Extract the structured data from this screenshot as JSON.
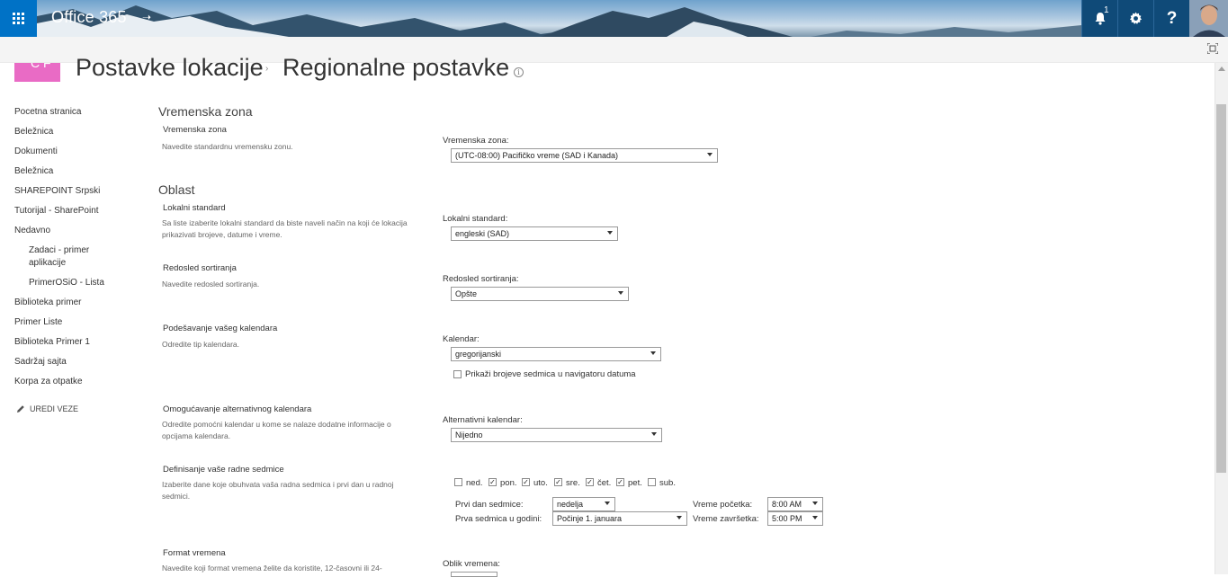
{
  "suite": {
    "brand": "Office 365",
    "notification_count": "1",
    "help_label": "?"
  },
  "page": {
    "breadcrumb_parent": "Postavke lokacije",
    "breadcrumb_separator": "›",
    "title": "Regionalne postavke",
    "logo_text": "C F"
  },
  "nav": {
    "items": [
      "Pocetna stranica",
      "Beležnica",
      "Dokumenti",
      "Beležnica",
      "SHAREPOINT Srpski",
      "Tutorijal - SharePoint",
      "Nedavno"
    ],
    "recent": [
      "Zadaci - primer aplikacije",
      "PrimerOSiO - Lista"
    ],
    "more": [
      "Biblioteka primer",
      "Primer Liste",
      "Biblioteka Primer 1",
      "Sadržaj sajta",
      "Korpa za otpatke"
    ],
    "edit_links": "UREDI VEZE"
  },
  "timezone_section": {
    "heading": "Vremenska zona",
    "group_title": "Vremenska zona",
    "group_desc": "Navedite standardnu vremensku zonu.",
    "field_label": "Vremenska zona:",
    "value": "(UTC-08:00) Pacifičko vreme (SAD i Kanada)"
  },
  "region_section": {
    "heading": "Oblast",
    "locale": {
      "title": "Lokalni standard",
      "desc": "Sa liste izaberite lokalni standard da biste naveli način na koji će lokacija prikazivati brojeve, datume i vreme.",
      "label": "Lokalni standard:",
      "value": "engleski (SAD)"
    },
    "sort": {
      "title": "Redosled sortiranja",
      "desc": "Navedite redosled sortiranja.",
      "label": "Redosled sortiranja:",
      "value": "Opšte"
    },
    "calendar": {
      "title": "Podešavanje vašeg kalendara",
      "desc": "Odredite tip kalendara.",
      "label": "Kalendar:",
      "value": "gregorijanski",
      "week_numbers": "Prikaži brojeve sedmica u navigatoru datuma"
    },
    "alt_calendar": {
      "title": "Omogućavanje alternativnog kalendara",
      "desc": "Odredite pomoćni kalendar u kome se nalaze dodatne informacije o opcijama kalendara.",
      "label": "Alternativni kalendar:",
      "value": "Nijedno"
    },
    "work_week": {
      "title": "Definisanje vaše radne sedmice",
      "desc": "Izaberite dane koje obuhvata vaša radna sedmica i prvi dan u radnoj sedmici.",
      "days": [
        {
          "label": "ned.",
          "checked": false
        },
        {
          "label": "pon.",
          "checked": true
        },
        {
          "label": "uto.",
          "checked": true
        },
        {
          "label": "sre.",
          "checked": true
        },
        {
          "label": "čet.",
          "checked": true
        },
        {
          "label": "pet.",
          "checked": true
        },
        {
          "label": "sub.",
          "checked": false
        }
      ],
      "first_day_label": "Prvi dan sedmice:",
      "first_day_value": "nedelja",
      "first_week_label": "Prva sedmica u godini:",
      "first_week_value": "Počinje 1. januara",
      "start_time_label": "Vreme početka:",
      "start_time_value": "8:00 AM",
      "end_time_label": "Vreme završetka:",
      "end_time_value": "5:00 PM"
    },
    "time_format": {
      "title": "Format vremena",
      "desc": "Navedite koji format vremena želite da koristite, 12-časovni ili 24-",
      "label": "Oblik vremena:"
    }
  },
  "colors": {
    "suite_bar": "#0078d7",
    "site_logo": "#e96bc5"
  }
}
